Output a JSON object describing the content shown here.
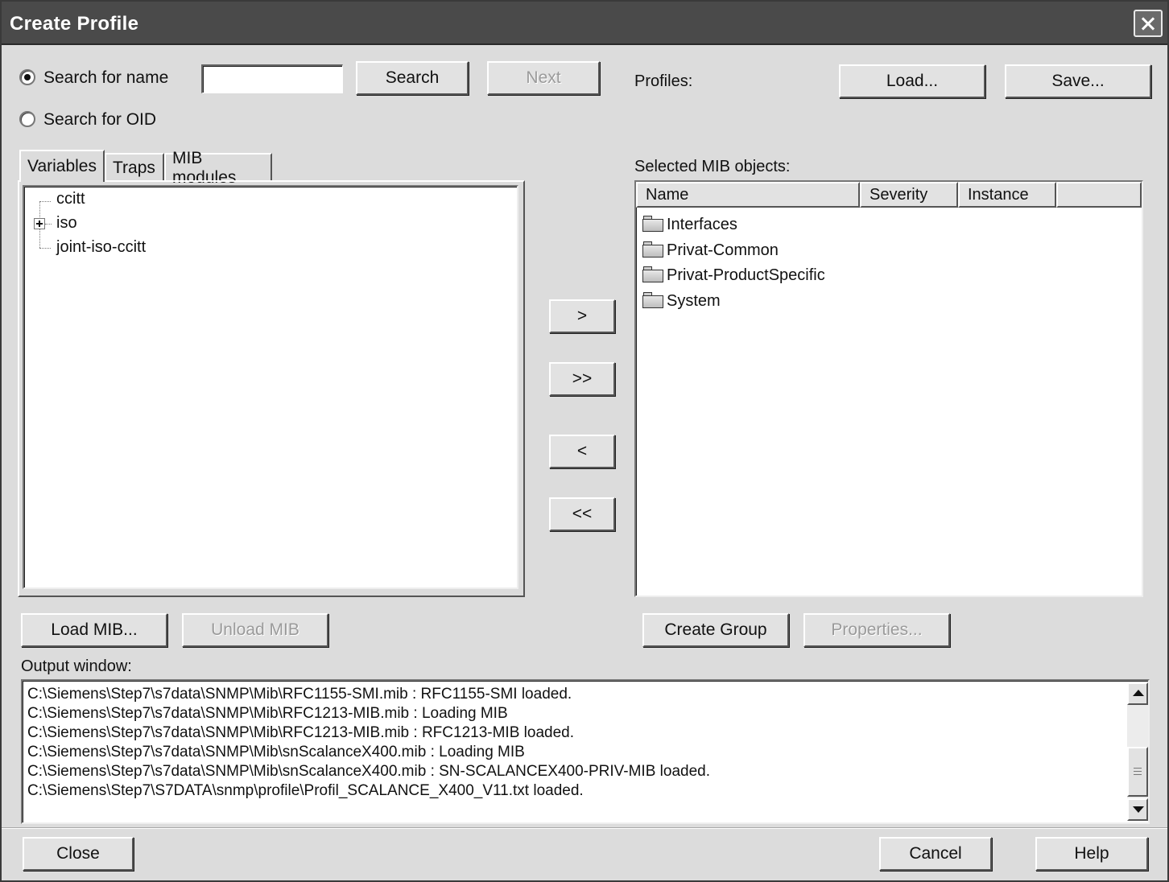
{
  "window": {
    "title": "Create Profile",
    "close_icon": "close-icon"
  },
  "search": {
    "name_radio_label": "Search for name",
    "oid_radio_label": "Search for OID",
    "selected": "name",
    "input_value": "",
    "search_button": "Search",
    "next_button": "Next"
  },
  "profiles": {
    "label": "Profiles:",
    "load_button": "Load...",
    "save_button": "Save..."
  },
  "tabs": [
    {
      "label": "Variables",
      "active": true
    },
    {
      "label": "Traps",
      "active": false
    },
    {
      "label": "MIB modules",
      "active": false
    }
  ],
  "tree": {
    "items": [
      {
        "label": "ccitt",
        "expandable": false
      },
      {
        "label": "iso",
        "expandable": true
      },
      {
        "label": "joint-iso-ccitt",
        "expandable": false
      }
    ]
  },
  "transfer": {
    "add_one": ">",
    "add_all": ">>",
    "remove_one": "<",
    "remove_all": "<<"
  },
  "selected_objects": {
    "label": "Selected MIB objects:",
    "columns": [
      "Name",
      "Severity",
      "Instance"
    ],
    "items": [
      {
        "label": "Interfaces",
        "icon": "folder-icon"
      },
      {
        "label": "Privat-Common",
        "icon": "folder-icon"
      },
      {
        "label": "Privat-ProductSpecific",
        "icon": "folder-icon"
      },
      {
        "label": "System",
        "icon": "folder-icon"
      }
    ]
  },
  "mib_buttons": {
    "load_mib": "Load MIB...",
    "unload_mib": "Unload MIB"
  },
  "group_buttons": {
    "create_group": "Create Group",
    "properties": "Properties..."
  },
  "output": {
    "label": "Output window:",
    "lines": [
      "C:\\Siemens\\Step7\\s7data\\SNMP\\Mib\\RFC1155-SMI.mib : RFC1155-SMI loaded.",
      "C:\\Siemens\\Step7\\s7data\\SNMP\\Mib\\RFC1213-MIB.mib : Loading MIB",
      "C:\\Siemens\\Step7\\s7data\\SNMP\\Mib\\RFC1213-MIB.mib : RFC1213-MIB loaded.",
      "C:\\Siemens\\Step7\\s7data\\SNMP\\Mib\\snScalanceX400.mib : Loading MIB",
      "C:\\Siemens\\Step7\\s7data\\SNMP\\Mib\\snScalanceX400.mib : SN-SCALANCEX400-PRIV-MIB loaded.",
      "C:\\Siemens\\Step7\\S7DATA\\snmp\\profile\\Profil_SCALANCE_X400_V11.txt loaded."
    ]
  },
  "footer": {
    "close_button": "Close",
    "cancel_button": "Cancel",
    "help_button": "Help"
  }
}
